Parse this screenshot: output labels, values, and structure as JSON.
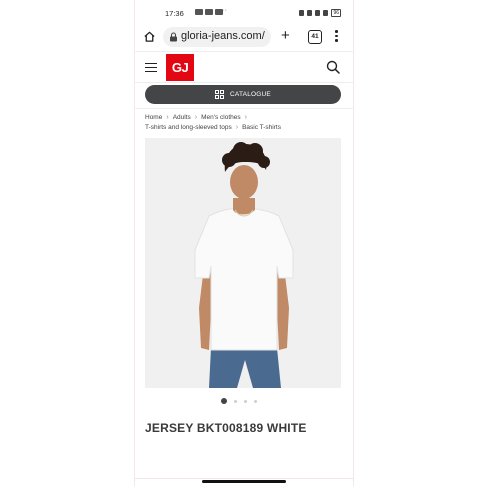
{
  "status_bar": {
    "time": "17:36",
    "dots": "···",
    "battery": "96"
  },
  "browser": {
    "url": "gloria-jeans.com/",
    "tab_count": "41"
  },
  "site": {
    "logo": "GJ",
    "catalogue_label": "CATALOGUE",
    "accent_color": "#e30613"
  },
  "breadcrumb": {
    "row1": [
      "Home",
      "Adults",
      "Men's clothes"
    ],
    "row2": [
      "T-shirts and long-sleeved tops",
      "Basic T-shirts"
    ]
  },
  "product": {
    "title": "JERSEY BKT008189 WHITE",
    "image_count": 4,
    "active_image": 1
  },
  "icons": [
    "home-icon",
    "lock-icon",
    "plus-icon",
    "tabs-icon",
    "menu-icon",
    "hamburger-icon",
    "search-icon",
    "catalogue-grid-icon"
  ]
}
